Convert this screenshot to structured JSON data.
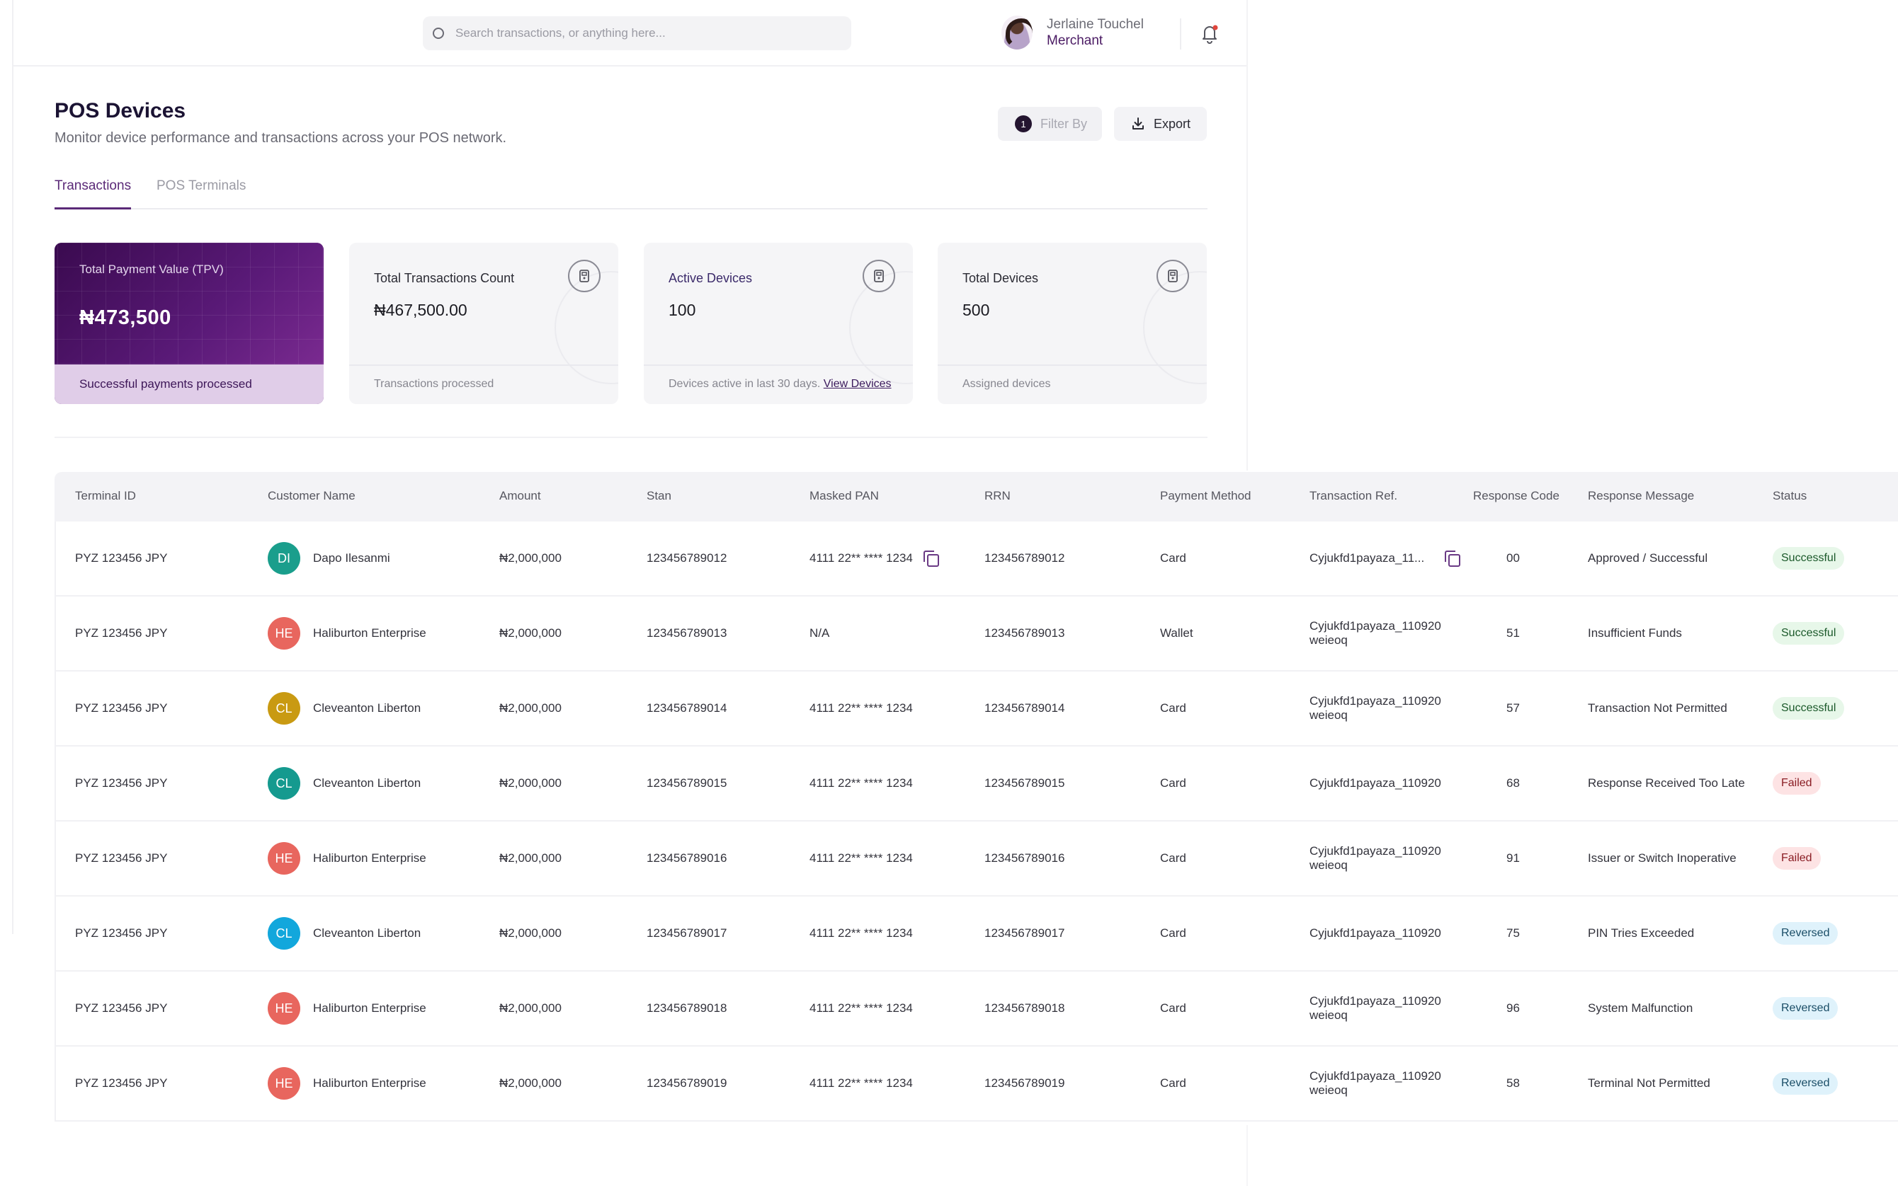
{
  "topbar": {
    "search_placeholder": "Search transactions, or anything here...",
    "user_name": "Jerlaine Touchel",
    "user_role": "Merchant"
  },
  "header": {
    "title": "POS Devices",
    "subtitle": "Monitor device performance and transactions across your POS network.",
    "filter_count": "1",
    "filter_label": "Filter By",
    "export_label": "Export"
  },
  "tabs": [
    {
      "label": "Transactions",
      "active": true
    },
    {
      "label": "POS Terminals",
      "active": false
    }
  ],
  "cards": [
    {
      "label": "Total Payment Value (TPV)",
      "value": "₦473,500",
      "footer": "Successful payments processed"
    },
    {
      "label": "Total Transactions Count",
      "value": "₦467,500.00",
      "footer": "Transactions processed"
    },
    {
      "label": "Active Devices",
      "value": "100",
      "footer": "Devices active in last 30 days.",
      "footer_link": "View Devices"
    },
    {
      "label": "Total Devices",
      "value": "500",
      "footer": "Assigned devices"
    }
  ],
  "table": {
    "columns": [
      "Terminal ID",
      "Customer Name",
      "Amount",
      "Stan",
      "Masked PAN",
      "RRN",
      "Payment Method",
      "Transaction Ref.",
      "Response Code",
      "Response Message",
      "Status"
    ],
    "rows": [
      {
        "terminal": "PYZ 123456 JPY",
        "initials": "DI",
        "avatar_color": "#1a9e8c",
        "customer": "Dapo Ilesanmi",
        "amount": "₦2,000,000",
        "stan": "123456789012",
        "pan": "4111 22** **** 1234",
        "pan_copy": true,
        "rrn": "123456789012",
        "method": "Card",
        "ref": "Cyjukfd1payaza_11...",
        "ref_copy": true,
        "code": "00",
        "message": "Approved / Successful",
        "status": "Successful",
        "status_type": "success"
      },
      {
        "terminal": "PYZ 123456 JPY",
        "initials": "HE",
        "avatar_color": "#e8665e",
        "customer": "Haliburton Enterprise",
        "amount": "₦2,000,000",
        "stan": "123456789013",
        "pan": "N/A",
        "pan_copy": false,
        "rrn": "123456789013",
        "method": "Wallet",
        "ref": "Cyjukfd1payaza_110920 weieoq",
        "ref_copy": false,
        "code": "51",
        "message": "Insufficient Funds",
        "status": "Successful",
        "status_type": "success"
      },
      {
        "terminal": "PYZ 123456 JPY",
        "initials": "CL",
        "avatar_color": "#c99a12",
        "customer": "Cleveanton Liberton",
        "amount": "₦2,000,000",
        "stan": "123456789014",
        "pan": "4111 22** **** 1234",
        "pan_copy": false,
        "rrn": "123456789014",
        "method": "Card",
        "ref": "Cyjukfd1payaza_110920 weieoq",
        "ref_copy": false,
        "code": "57",
        "message": "Transaction Not Permitted",
        "status": "Successful",
        "status_type": "success"
      },
      {
        "terminal": "PYZ 123456 JPY",
        "initials": "CL",
        "avatar_color": "#159a8f",
        "customer": "Cleveanton Liberton",
        "amount": "₦2,000,000",
        "stan": "123456789015",
        "pan": "4111 22** **** 1234",
        "pan_copy": false,
        "rrn": "123456789015",
        "method": "Card",
        "ref": "Cyjukfd1payaza_110920",
        "ref_copy": false,
        "code": "68",
        "message": "Response Received Too Late",
        "status": "Failed",
        "status_type": "failed"
      },
      {
        "terminal": "PYZ 123456 JPY",
        "initials": "HE",
        "avatar_color": "#e8665e",
        "customer": "Haliburton Enterprise",
        "amount": "₦2,000,000",
        "stan": "123456789016",
        "pan": "4111 22** **** 1234",
        "pan_copy": false,
        "rrn": "123456789016",
        "method": "Card",
        "ref": "Cyjukfd1payaza_110920 weieoq",
        "ref_copy": false,
        "code": "91",
        "message": "Issuer or Switch Inoperative",
        "status": "Failed",
        "status_type": "failed"
      },
      {
        "terminal": "PYZ 123456 JPY",
        "initials": "CL",
        "avatar_color": "#12a7dc",
        "customer": "Cleveanton Liberton",
        "amount": "₦2,000,000",
        "stan": "123456789017",
        "pan": "4111 22** **** 1234",
        "pan_copy": false,
        "rrn": "123456789017",
        "method": "Card",
        "ref": "Cyjukfd1payaza_110920",
        "ref_copy": false,
        "code": "75",
        "message": "PIN Tries Exceeded",
        "status": "Reversed",
        "status_type": "reversed"
      },
      {
        "terminal": "PYZ 123456 JPY",
        "initials": "HE",
        "avatar_color": "#e8665e",
        "customer": "Haliburton Enterprise",
        "amount": "₦2,000,000",
        "stan": "123456789018",
        "pan": "4111 22** **** 1234",
        "pan_copy": false,
        "rrn": "123456789018",
        "method": "Card",
        "ref": "Cyjukfd1payaza_110920 weieoq",
        "ref_copy": false,
        "code": "96",
        "message": "System Malfunction",
        "status": "Reversed",
        "status_type": "reversed"
      },
      {
        "terminal": "PYZ 123456 JPY",
        "initials": "HE",
        "avatar_color": "#e8665e",
        "customer": "Haliburton Enterprise",
        "amount": "₦2,000,000",
        "stan": "123456789019",
        "pan": "4111 22** **** 1234",
        "pan_copy": false,
        "rrn": "123456789019",
        "method": "Card",
        "ref": "Cyjukfd1payaza_110920 weieoq",
        "ref_copy": false,
        "code": "58",
        "message": "Terminal Not Permitted",
        "status": "Reversed",
        "status_type": "reversed"
      }
    ]
  }
}
